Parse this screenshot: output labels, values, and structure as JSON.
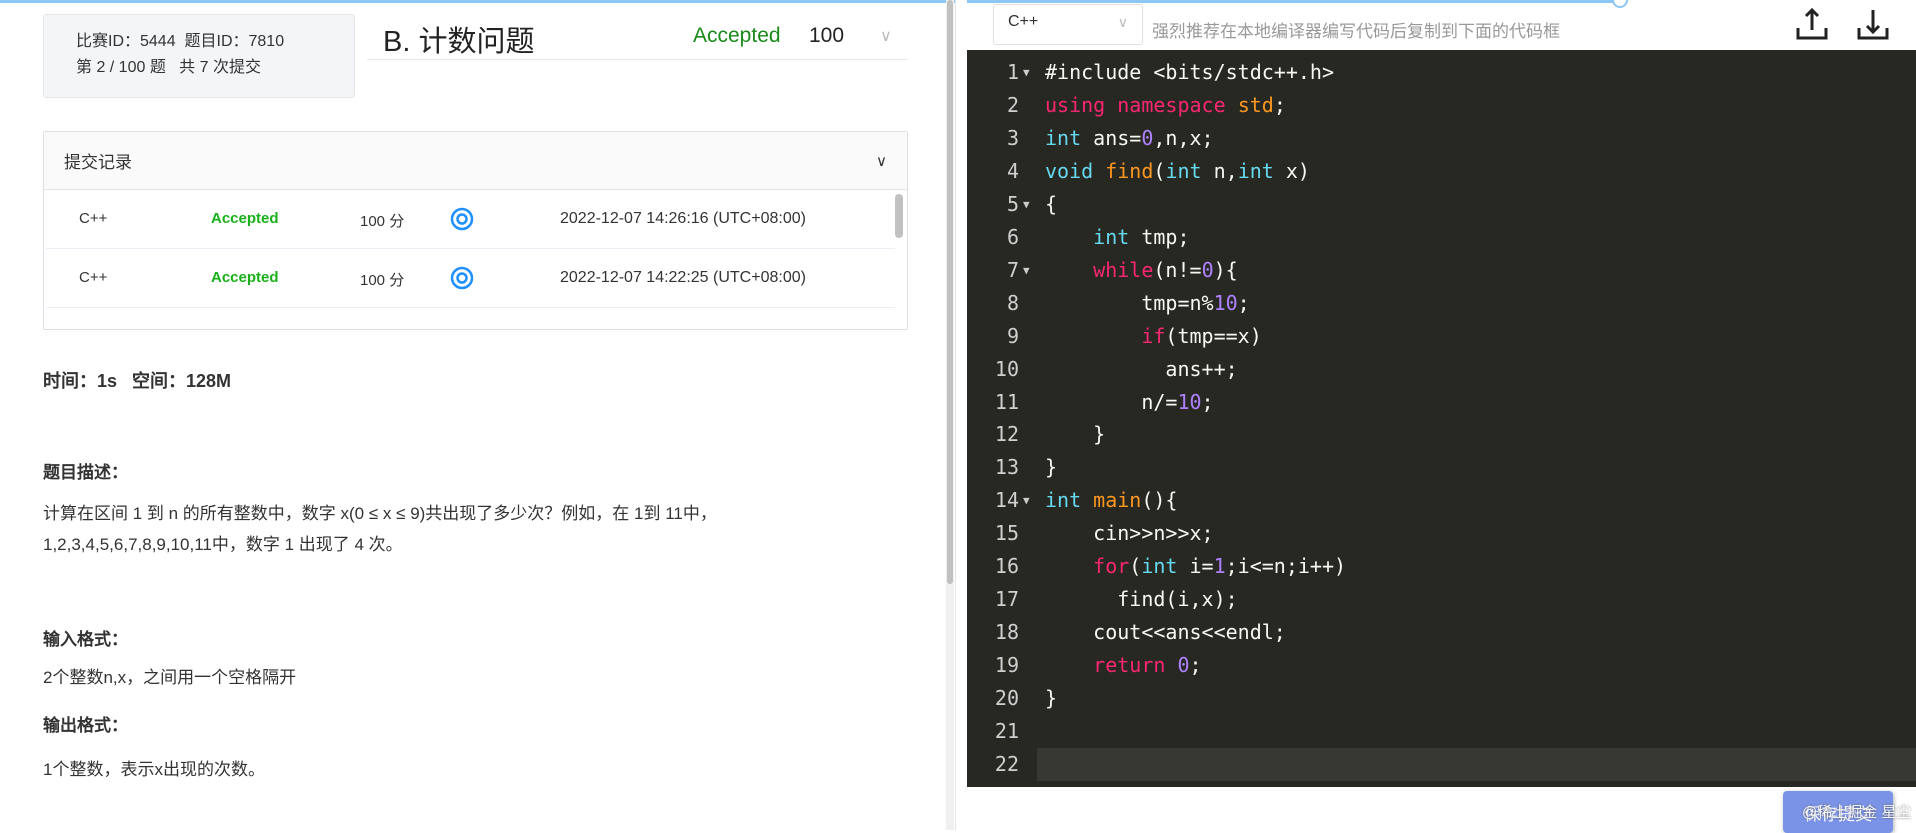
{
  "header": {
    "contest_id": "比赛ID：5444",
    "problem_id": "题目ID：7810",
    "position": "第 2 / 100 题",
    "submissions": "共 7 次提交",
    "title": "B. 计数问题",
    "status": "Accepted",
    "score": "100"
  },
  "submissions": {
    "title": "提交记录",
    "rows": [
      {
        "lang": "C++",
        "status": "Accepted",
        "score": "100 分",
        "time": "2022-12-07 14:26:16 (UTC+08:00)"
      },
      {
        "lang": "C++",
        "status": "Accepted",
        "score": "100 分",
        "time": "2022-12-07 14:22:25 (UTC+08:00)"
      }
    ]
  },
  "limits": "时间：1s   空间：128M",
  "desc_title": "题目描述：",
  "desc": [
    "计算在区间 1 到 n 的所有整数中，数字 x(0 ≤ x ≤ 9)共出现了多少次？例如，在 1到 11中，",
    "1,2,3,4,5,6,7,8,9,10,11中，数字 1 出现了 4 次。"
  ],
  "input_title": "输入格式：",
  "input": "2个整数n,x，之间用一个空格隔开",
  "output_title": "输出格式：",
  "output": "1个整数，表示x出现的次数。",
  "editor": {
    "language": "C++",
    "hint": "强烈推荐在本地编译器编写代码后复制到下面的代码框",
    "save": "保存提交",
    "watermark": "@稀土掘金 星尘",
    "colors": {
      "background": "#272822",
      "keyword": "#f92672",
      "type": "#66d9ef",
      "function": "#fd971f",
      "number": "#ae81ff"
    },
    "lines": [
      [
        [
          "",
          "#include <bits/stdc++.h>"
        ]
      ],
      [
        [
          "kw",
          "using"
        ],
        [
          "",
          " "
        ],
        [
          "kw",
          "namespace"
        ],
        [
          "",
          " "
        ],
        [
          "fn",
          "std"
        ],
        [
          "",
          ";"
        ]
      ],
      [
        [
          "ty",
          "int"
        ],
        [
          "",
          " ans="
        ],
        [
          "nu",
          "0"
        ],
        [
          "",
          ",n,x;"
        ]
      ],
      [
        [
          "ty",
          "void"
        ],
        [
          "",
          " "
        ],
        [
          "fn",
          "find"
        ],
        [
          "",
          "("
        ],
        [
          "ty",
          "int"
        ],
        [
          "",
          " n,"
        ],
        [
          "ty",
          "int"
        ],
        [
          "",
          " x)"
        ]
      ],
      [
        [
          "",
          "{"
        ]
      ],
      [
        [
          "",
          "    "
        ],
        [
          "ty",
          "int"
        ],
        [
          "",
          " tmp;"
        ]
      ],
      [
        [
          "",
          "    "
        ],
        [
          "kw",
          "while"
        ],
        [
          "",
          "(n!="
        ],
        [
          "nu",
          "0"
        ],
        [
          "",
          "){"
        ]
      ],
      [
        [
          "",
          "        tmp=n%"
        ],
        [
          "nu",
          "10"
        ],
        [
          "",
          ";"
        ]
      ],
      [
        [
          "",
          "        "
        ],
        [
          "kw",
          "if"
        ],
        [
          "",
          "(tmp==x)"
        ]
      ],
      [
        [
          "",
          "          ans++;"
        ]
      ],
      [
        [
          "",
          "        n/="
        ],
        [
          "nu",
          "10"
        ],
        [
          "",
          ";"
        ]
      ],
      [
        [
          "",
          "    }"
        ]
      ],
      [
        [
          "",
          "}"
        ]
      ],
      [
        [
          "ty",
          "int"
        ],
        [
          "",
          " "
        ],
        [
          "fn",
          "main"
        ],
        [
          "",
          "(){"
        ]
      ],
      [
        [
          "",
          "    cin>>n>>x;"
        ]
      ],
      [
        [
          "",
          "    "
        ],
        [
          "kw",
          "for"
        ],
        [
          "",
          "("
        ],
        [
          "ty",
          "int"
        ],
        [
          "",
          " i="
        ],
        [
          "nu",
          "1"
        ],
        [
          "",
          ";i<=n;i++)"
        ]
      ],
      [
        [
          "",
          "      find(i,x);"
        ]
      ],
      [
        [
          "",
          "    cout<<ans<<endl;"
        ]
      ],
      [
        [
          "",
          "    "
        ],
        [
          "kw",
          "return"
        ],
        [
          "",
          " "
        ],
        [
          "nu",
          "0"
        ],
        [
          "",
          ";"
        ]
      ],
      [
        [
          "",
          "}"
        ]
      ],
      [],
      []
    ],
    "fold_lines": [
      1,
      5,
      7,
      14
    ]
  }
}
